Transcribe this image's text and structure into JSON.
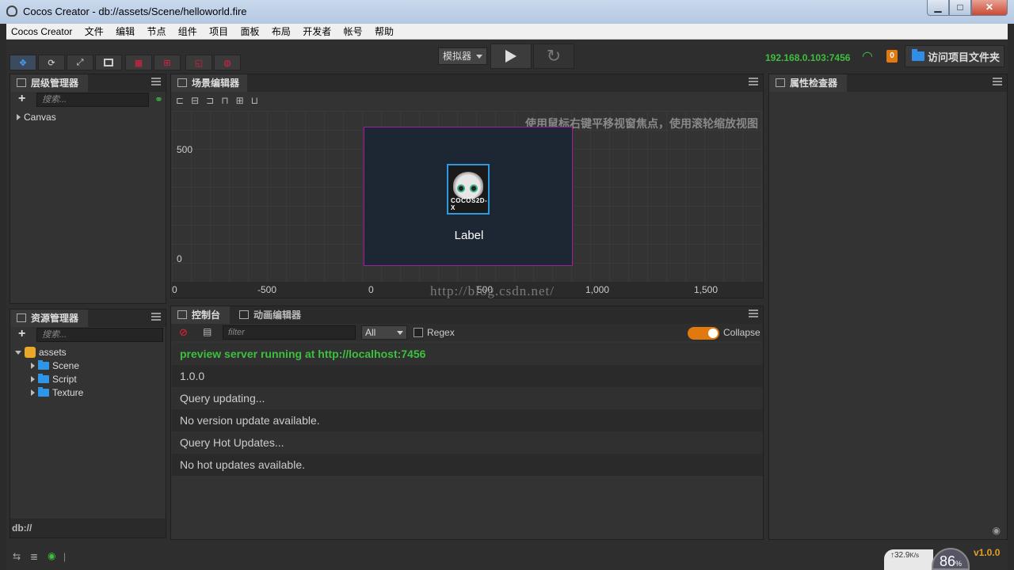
{
  "window": {
    "title": "Cocos Creator - db://assets/Scene/helloworld.fire",
    "min": "▁",
    "max": "□",
    "close": "✕"
  },
  "menubar": [
    "Cocos Creator",
    "文件",
    "编辑",
    "节点",
    "组件",
    "项目",
    "面板",
    "布局",
    "开发者",
    "帐号",
    "帮助"
  ],
  "toolbar": {
    "simulator": "模拟器",
    "ip": "192.168.0.103:7456",
    "badge": "0",
    "open_project_folder": "访问项目文件夹",
    "reload_glyph": "↻"
  },
  "hierarchy": {
    "tab": "层级管理器",
    "search_placeholder": "搜索...",
    "nodes": [
      "Canvas"
    ]
  },
  "assets": {
    "tab": "资源管理器",
    "search_placeholder": "搜索...",
    "root": "assets",
    "children": [
      "Scene",
      "Script",
      "Texture"
    ],
    "footer": "db://"
  },
  "scene": {
    "tab": "场景编辑器",
    "hint": "使用鼠标右键平移视窗焦点，使用滚轮缩放视图",
    "y_ticks": [
      "500",
      "0"
    ],
    "x_ticks": [
      "0",
      "-500",
      "0",
      "500",
      "1,000",
      "1,500"
    ],
    "label": "Label",
    "logo_text": "COCOS2D-X"
  },
  "watermark": "http://blog.csdn.net/",
  "inspector": {
    "tab": "属性检查器"
  },
  "console": {
    "tab": "控制台",
    "tab2": "动画编辑器",
    "filter_placeholder": "filter",
    "level": "All",
    "regex_label": "Regex",
    "collapse_label": "Collapse",
    "lines": [
      "preview server running at http://localhost:7456",
      "1.0.0",
      "Query updating...",
      "No version update available.",
      "Query Hot Updates...",
      "No hot updates available."
    ]
  },
  "status": {
    "version": "v1.0.0",
    "net_speed": "32.9",
    "net_unit": "K/s",
    "percent": "86",
    "percent_unit": "%"
  }
}
